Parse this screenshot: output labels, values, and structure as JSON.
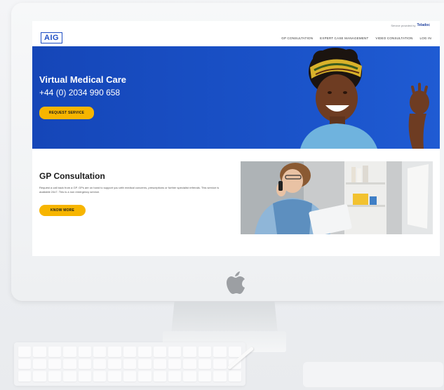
{
  "topbar": {
    "provided_text": "Service provided by",
    "provider": "Teladoc"
  },
  "header": {
    "logo": "AIG",
    "nav": [
      "GP CONSULTATION",
      "EXPERT CASE MANAGEMENT",
      "VIDEO CONSULTATION",
      "LOG IN"
    ]
  },
  "hero": {
    "title": "Virtual Medical Care",
    "phone": "+44 (0) 2034 990 658",
    "button": "REQUEST SERVICE"
  },
  "gp": {
    "title": "GP Consultation",
    "description": "Request a call back from a GP. GPs are on hand to support you with medical concerns, prescriptions or further specialist referrals. This service is available 24x7. This is a non emergency service.",
    "button": "KNOW MORE"
  },
  "colors": {
    "brand_blue": "#1a52c8",
    "accent_yellow": "#f7b500"
  }
}
